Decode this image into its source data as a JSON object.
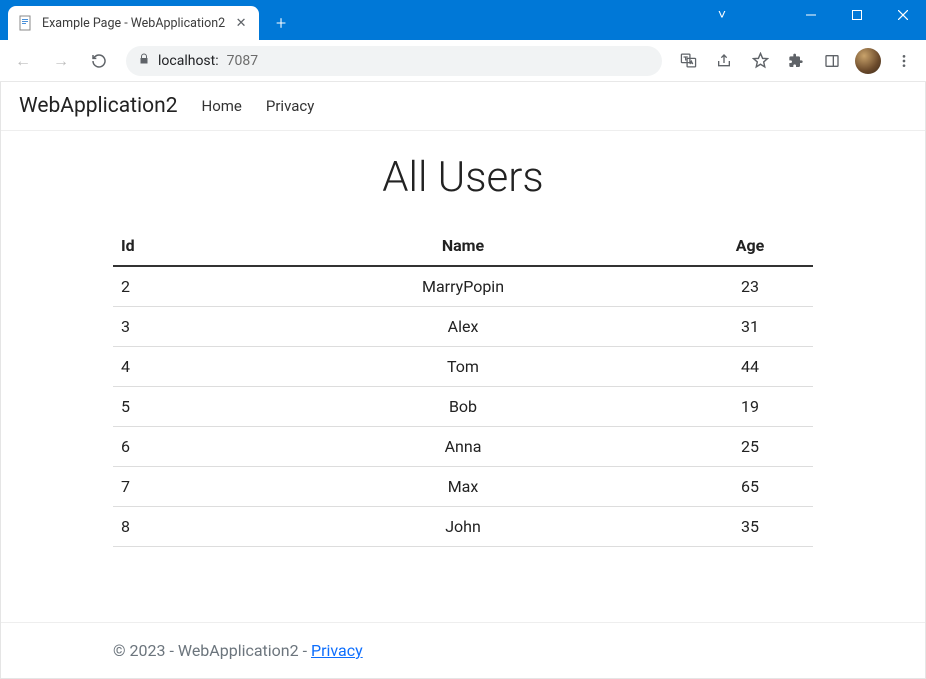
{
  "browser": {
    "tab_title": "Example Page - WebApplication2",
    "url_host": "localhost:",
    "url_port": "7087"
  },
  "site": {
    "brand": "WebApplication2",
    "nav": {
      "home": "Home",
      "privacy": "Privacy"
    }
  },
  "page": {
    "heading": "All Users",
    "columns": {
      "id": "Id",
      "name": "Name",
      "age": "Age"
    },
    "rows": [
      {
        "id": "2",
        "name": "MarryPopin",
        "age": "23"
      },
      {
        "id": "3",
        "name": "Alex",
        "age": "31"
      },
      {
        "id": "4",
        "name": "Tom",
        "age": "44"
      },
      {
        "id": "5",
        "name": "Bob",
        "age": "19"
      },
      {
        "id": "6",
        "name": "Anna",
        "age": "25"
      },
      {
        "id": "7",
        "name": "Max",
        "age": "65"
      },
      {
        "id": "8",
        "name": "John",
        "age": "35"
      }
    ]
  },
  "footer": {
    "text": "© 2023 - WebApplication2 - ",
    "link": "Privacy"
  }
}
